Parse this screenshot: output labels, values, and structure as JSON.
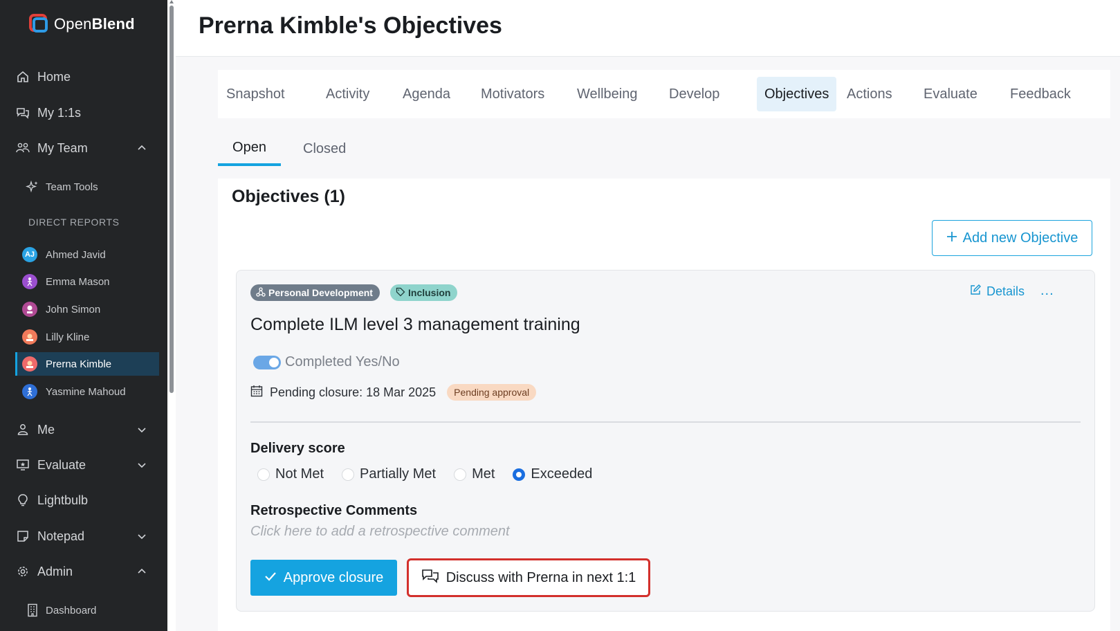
{
  "app": {
    "name_a": "Open",
    "name_b": "Blend"
  },
  "sidebar": {
    "nav": [
      {
        "label": "Home",
        "icon": "home-icon"
      },
      {
        "label": "My 1:1s",
        "icon": "chat-icon"
      },
      {
        "label": "My Team",
        "icon": "team-icon",
        "expanded": true
      }
    ],
    "team_tools": "Team Tools",
    "direct_reports_label": "DIRECT REPORTS",
    "reports": [
      {
        "name": "Ahmed Javid",
        "initials": "AJ",
        "color": "#2aa3e4"
      },
      {
        "name": "Emma Mason",
        "initials": "",
        "color": "#9b4fcf"
      },
      {
        "name": "John Simon",
        "initials": "",
        "color": "#b04a94"
      },
      {
        "name": "Lilly Kline",
        "initials": "",
        "color": "#f07a5a"
      },
      {
        "name": "Prerna Kimble",
        "initials": "",
        "color": "#ef6a6a"
      },
      {
        "name": "Yasmine Mahoud",
        "initials": "",
        "color": "#2f6fd6"
      }
    ],
    "lower_nav": [
      {
        "label": "Me",
        "icon": "person-icon",
        "chevron": "down"
      },
      {
        "label": "Evaluate",
        "icon": "evaluate-icon",
        "chevron": "down"
      },
      {
        "label": "Lightbulb",
        "icon": "lightbulb-icon",
        "chevron": ""
      },
      {
        "label": "Notepad",
        "icon": "notepad-icon",
        "chevron": "down"
      },
      {
        "label": "Admin",
        "icon": "gear-icon",
        "chevron": "up"
      }
    ],
    "dashboard": "Dashboard"
  },
  "header": {
    "title": "Prerna Kimble's Objectives"
  },
  "tabs": [
    "Snapshot",
    "Activity",
    "Agenda",
    "Motivators",
    "Wellbeing",
    "Develop",
    "Objectives",
    "Actions",
    "Evaluate",
    "Feedback"
  ],
  "active_tab": "Objectives",
  "subtabs": [
    "Open",
    "Closed"
  ],
  "objectives": {
    "heading": "Objectives (1)",
    "add_label": "Add new Objective"
  },
  "card": {
    "tags": [
      "Personal Development",
      "Inclusion"
    ],
    "details_label": "Details",
    "more_label": "...",
    "title": "Complete ILM level 3 management training",
    "toggle_label": "Completed Yes/No",
    "pending_text": "Pending closure: 18 Mar 2025",
    "pending_badge": "Pending approval",
    "score_label": "Delivery score",
    "score_options": [
      "Not Met",
      "Partially Met",
      "Met",
      "Exceeded"
    ],
    "score_selected": "Exceeded",
    "retro_label": "Retrospective Comments",
    "retro_placeholder": "Click here to add a retrospective comment",
    "approve_label": "Approve closure",
    "discuss_label": "Discuss with Prerna in next 1:1"
  },
  "colors": {
    "accent": "#15a3e0",
    "sidebar": "#232527",
    "highlight": "#d3302c"
  }
}
